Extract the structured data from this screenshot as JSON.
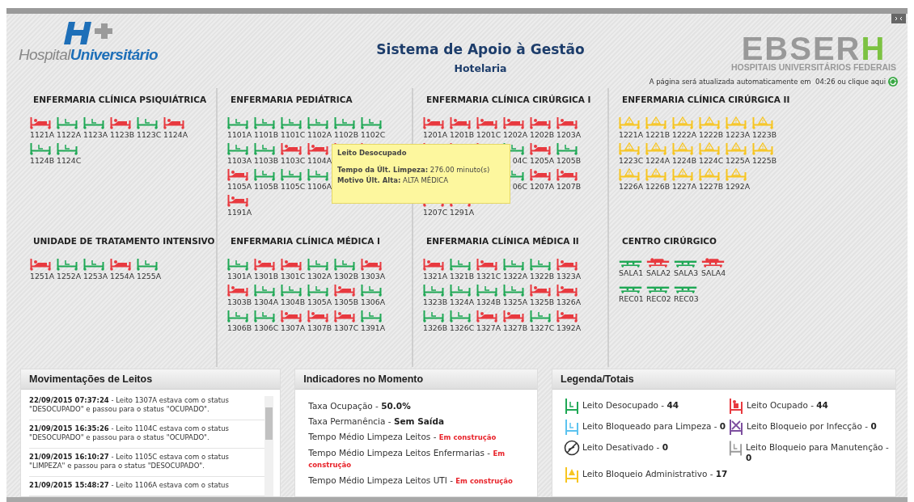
{
  "header": {
    "logo_prefix": "Hospital",
    "logo_name": "Universitário",
    "title": "Sistema de Apoio à Gestão",
    "subtitle": "Hotelaria",
    "brand": "EBSER**H**",
    "brand_caption": "HOSPITAIS UNIVERSITÁRIOS FEDERAIS",
    "refresh_text": "A página será atualizada automaticamente em  04:26 ou clique aqui"
  },
  "wards": [
    {
      "name": "ENFERMARIA CLÍNICA PSIQUIÁTRICA",
      "kind": "beds",
      "rows": [
        [
          {
            "label": "1121A",
            "kind": "occupied"
          },
          {
            "label": "1122A",
            "kind": "free"
          },
          {
            "label": "1123A",
            "kind": "free"
          },
          {
            "label": "1123B",
            "kind": "occupied"
          },
          {
            "label": "1123C",
            "kind": "free"
          },
          {
            "label": "1124A",
            "kind": "occupied"
          }
        ],
        [
          {
            "label": "1124B",
            "kind": "free"
          },
          {
            "label": "1124C",
            "kind": "free"
          }
        ]
      ]
    },
    {
      "name": "ENFERMARIA PEDIÁTRICA",
      "kind": "beds",
      "rows": [
        [
          {
            "label": "1101A",
            "kind": "free"
          },
          {
            "label": "1101B",
            "kind": "free"
          },
          {
            "label": "1101C",
            "kind": "free"
          },
          {
            "label": "1102A",
            "kind": "free"
          },
          {
            "label": "1102B",
            "kind": "free"
          },
          {
            "label": "1102C",
            "kind": "free"
          }
        ],
        [
          {
            "label": "1103A",
            "kind": "free"
          },
          {
            "label": "1103B",
            "kind": "free"
          },
          {
            "label": "1103C",
            "kind": "occupied"
          },
          {
            "label": "1104A",
            "kind": "occupied"
          },
          {
            "kind": "occupied"
          },
          {
            "kind": "occupied"
          }
        ],
        [
          {
            "label": "1105A",
            "kind": "occupied"
          },
          {
            "label": "1105B",
            "kind": "free"
          },
          {
            "label": "1105C",
            "kind": "free"
          },
          {
            "label": "1106A",
            "kind": "free"
          },
          null,
          null
        ],
        [
          {
            "label": "1191A",
            "kind": "occupied"
          }
        ]
      ]
    },
    {
      "name": "ENFERMARIA CLÍNICA CIRÚRGICA I",
      "kind": "beds",
      "rows": [
        [
          {
            "label": "1201A",
            "kind": "occupied"
          },
          {
            "label": "1201B",
            "kind": "occupied"
          },
          {
            "label": "1201C",
            "kind": "occupied"
          },
          {
            "label": "1202A",
            "kind": "occupied"
          },
          {
            "label": "1202B",
            "kind": "occupied"
          },
          {
            "label": "1203A",
            "kind": "occupied"
          }
        ],
        [
          {
            "kind": "occupied"
          },
          {
            "kind": "occupied"
          },
          {
            "kind": "occupied"
          },
          {
            "label": "04C",
            "kind": "free"
          },
          {
            "label": "1205A",
            "kind": "occupied"
          },
          {
            "label": "1205B",
            "kind": "free"
          }
        ],
        [
          null,
          null,
          null,
          {
            "label": "06C",
            "kind": "free"
          },
          {
            "label": "1207A",
            "kind": "occupied"
          },
          {
            "label": "1207B",
            "kind": "occupied"
          }
        ],
        [
          {
            "label": "1207C",
            "kind": "occupied"
          },
          {
            "label": "1291A",
            "kind": "occupied"
          }
        ]
      ]
    },
    {
      "name": "ENFERMARIA CLÍNICA CIRÚRGICA II",
      "kind": "beds",
      "rows": [
        [
          {
            "label": "1221A",
            "kind": "blocked"
          },
          {
            "label": "1221B",
            "kind": "blocked"
          },
          {
            "label": "1222A",
            "kind": "blocked"
          },
          {
            "label": "1222B",
            "kind": "blocked"
          },
          {
            "label": "1223A",
            "kind": "blocked"
          },
          {
            "label": "1223B",
            "kind": "blocked"
          }
        ],
        [
          {
            "label": "1223C",
            "kind": "blocked"
          },
          {
            "label": "1224A",
            "kind": "blocked"
          },
          {
            "label": "1224B",
            "kind": "blocked"
          },
          {
            "label": "1224C",
            "kind": "blocked"
          },
          {
            "label": "1225A",
            "kind": "blocked"
          },
          {
            "label": "1225B",
            "kind": "blocked"
          }
        ],
        [
          {
            "label": "1226A",
            "kind": "blocked"
          },
          {
            "label": "1226B",
            "kind": "blocked"
          },
          {
            "label": "1227A",
            "kind": "blocked"
          },
          {
            "label": "1227B",
            "kind": "blocked"
          },
          {
            "label": "1292A",
            "kind": "blocked"
          }
        ]
      ]
    },
    {
      "name": "UNIDADE DE TRATAMENTO INTENSIVO",
      "kind": "beds",
      "rows": [
        [
          {
            "label": "1251A",
            "kind": "occupied"
          },
          {
            "label": "1252A",
            "kind": "free"
          },
          {
            "label": "1253A",
            "kind": "free"
          },
          {
            "label": "1254A",
            "kind": "occupied"
          },
          {
            "label": "1255A",
            "kind": "free"
          }
        ]
      ]
    },
    {
      "name": "ENFERMARIA CLÍNICA MÉDICA I",
      "kind": "beds",
      "rows": [
        [
          {
            "label": "1301A",
            "kind": "free"
          },
          {
            "label": "1301B",
            "kind": "occupied"
          },
          {
            "label": "1301C",
            "kind": "occupied"
          },
          {
            "label": "1302A",
            "kind": "free"
          },
          {
            "label": "1302B",
            "kind": "free"
          },
          {
            "label": "1303A",
            "kind": "occupied"
          }
        ],
        [
          {
            "label": "1303B",
            "kind": "occupied"
          },
          {
            "label": "1304A",
            "kind": "free"
          },
          {
            "label": "1304B",
            "kind": "free"
          },
          {
            "label": "1305A",
            "kind": "free"
          },
          {
            "label": "1305B",
            "kind": "occupied"
          },
          {
            "label": "1306A",
            "kind": "free"
          }
        ],
        [
          {
            "label": "1306B",
            "kind": "free"
          },
          {
            "label": "1306C",
            "kind": "free"
          },
          {
            "label": "1307A",
            "kind": "occupied"
          },
          {
            "label": "1307B",
            "kind": "occupied"
          },
          {
            "label": "1307C",
            "kind": "occupied"
          },
          {
            "label": "1391A",
            "kind": "free"
          }
        ]
      ]
    },
    {
      "name": "ENFERMARIA CLÍNICA MÉDICA II",
      "kind": "beds",
      "rows": [
        [
          {
            "label": "1321A",
            "kind": "occupied"
          },
          {
            "label": "1321B",
            "kind": "free"
          },
          {
            "label": "1321C",
            "kind": "occupied"
          },
          {
            "label": "1322A",
            "kind": "free"
          },
          {
            "label": "1322B",
            "kind": "free"
          },
          {
            "label": "1323A",
            "kind": "occupied"
          }
        ],
        [
          {
            "label": "1323B",
            "kind": "free"
          },
          {
            "label": "1324A",
            "kind": "free"
          },
          {
            "label": "1324B",
            "kind": "free"
          },
          {
            "label": "1325A",
            "kind": "free"
          },
          {
            "label": "1325B",
            "kind": "occupied"
          },
          {
            "label": "1326A",
            "kind": "occupied"
          }
        ],
        [
          {
            "label": "1326B",
            "kind": "free"
          },
          {
            "label": "1326C",
            "kind": "free"
          },
          {
            "label": "1327A",
            "kind": "occupied"
          },
          {
            "label": "1327B",
            "kind": "occupied"
          },
          {
            "label": "1327C",
            "kind": "free"
          },
          {
            "label": "1392A",
            "kind": "occupied"
          }
        ]
      ]
    },
    {
      "name": "CENTRO CIRÚRGICO",
      "kind": "rooms",
      "rows": [
        [
          {
            "label": "SALA1",
            "kind": "free"
          },
          {
            "label": "SALA2",
            "kind": "occupied"
          },
          {
            "label": "SALA3",
            "kind": "free"
          },
          {
            "label": "SALA4",
            "kind": "occupied"
          }
        ],
        [
          {
            "label": "REC01",
            "kind": "free"
          },
          {
            "label": "REC02",
            "kind": "free"
          },
          {
            "label": "REC03",
            "kind": "free"
          }
        ]
      ]
    }
  ],
  "tooltip": {
    "title": "Leito Desocupado",
    "lines": [
      "**Tempo da Últ. Limpeza:** 276.00 minuto(s)",
      "**Motivo Últ. Alta:** ALTA MÉDICA"
    ]
  },
  "movements": {
    "title": "Movimentações de Leitos",
    "entries": [
      "**22/09/2015 07:37:24** - Leito 1307A estava com o status \"DESOCUPADO\" e passou para o status \"OCUPADO\".",
      "**21/09/2015 16:35:26** - Leito 1104C estava com o status \"DESOCUPADO\" e passou para o status \"OCUPADO\".",
      "**21/09/2015 16:10:27** - Leito 1105C estava com o status \"LIMPEZA\" e passou para o status \"DESOCUPADO\".",
      "**21/09/2015 15:48:27** - Leito 1106A estava com o status"
    ]
  },
  "indicators": {
    "title": "Indicadores no Momento",
    "items": [
      {
        "label": "Taxa Ocupação -",
        "value": "50.0%",
        "kind": "value"
      },
      {
        "label": "Taxa Permanência -",
        "value": "Sem Saída",
        "kind": "value"
      },
      {
        "label": "Tempo Médio Limpeza Leitos -",
        "value": "Em construção",
        "kind": "pending"
      },
      {
        "label": "Tempo Médio Limpeza Leitos Enfermarias -",
        "value": "Em construção",
        "kind": "pending"
      },
      {
        "label": "Tempo Médio Limpeza Leitos UTI -",
        "value": "Em construção",
        "kind": "pending"
      }
    ]
  },
  "legend": {
    "title": "Legenda/Totais",
    "items": [
      {
        "label": "Leito Desocupado -",
        "count": "44",
        "kind": "free"
      },
      {
        "label": "Leito Ocupado -",
        "count": "44",
        "kind": "occupied"
      },
      {
        "label": "Leito Bloqueado para Limpeza -",
        "count": "0",
        "kind": "cleaning"
      },
      {
        "label": "Leito Bloqueio por Infecção -",
        "count": "0",
        "kind": "infection"
      },
      {
        "label": "Leito Desativado -",
        "count": "0",
        "kind": "disabled"
      },
      {
        "label": "Leito Bloqueio para Manutenção -",
        "count": "0",
        "kind": "maintenance"
      },
      {
        "label": "Leito Bloqueio Administrativo -",
        "count": "17",
        "kind": "blocked"
      }
    ]
  }
}
